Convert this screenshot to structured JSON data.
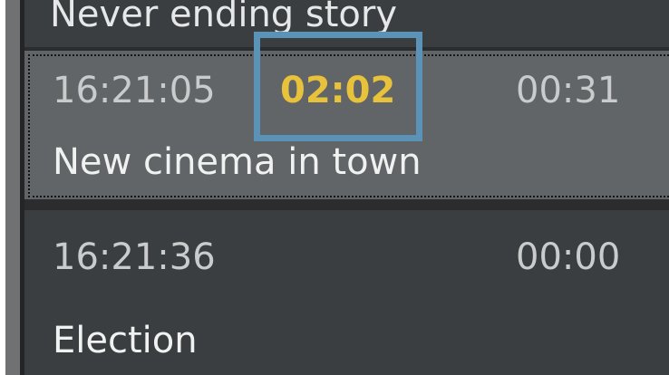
{
  "rundown": {
    "previous_item": {
      "title": "Never ending story"
    },
    "selected_item": {
      "start_time": "16:21:05",
      "remaining_time": "02:02",
      "duration": "00:31",
      "title": "New cinema in town"
    },
    "next_item": {
      "start_time": "16:21:36",
      "duration": "00:00",
      "title": "Election"
    }
  },
  "colors": {
    "remaining_time": "#e7c23a",
    "highlight_box": "#5b93b8",
    "selected_row": "#626567",
    "row": "#3b3e40"
  }
}
